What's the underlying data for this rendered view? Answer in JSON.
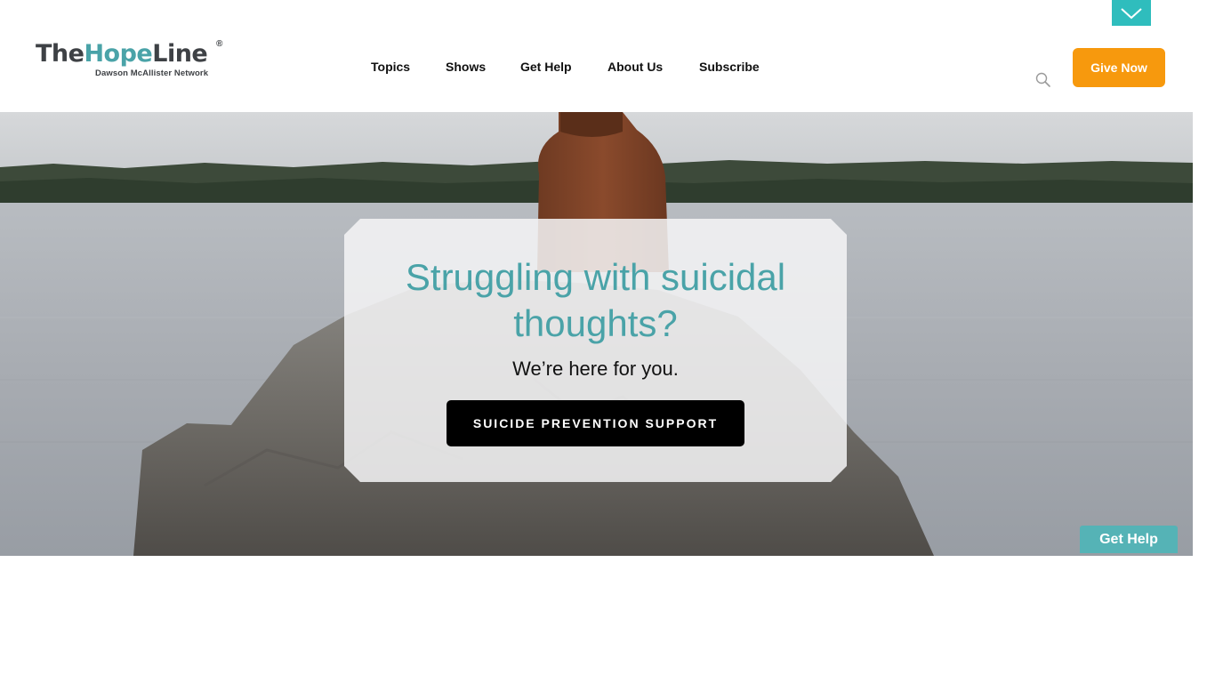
{
  "header": {
    "logo": {
      "the": "The",
      "hope": "Hope",
      "line": "Line",
      "registered": "®",
      "tagline": "Dawson McAllister Network"
    },
    "nav": [
      "Topics",
      "Shows",
      "Get Help",
      "About Us",
      "Subscribe"
    ],
    "search_icon": "search-icon",
    "give_label": "Give Now",
    "toggle_icon": "chevron-down-icon"
  },
  "hero": {
    "title": "Struggling with suicidal thoughts?",
    "subtitle": "We’re here for you.",
    "cta_label": "SUICIDE PREVENTION SUPPORT"
  },
  "floating": {
    "help_label": "Get Help"
  },
  "colors": {
    "brand_teal": "#4aa3a8",
    "accent_orange": "#f7990d",
    "tab_teal": "#2fbdbd",
    "help_teal": "#55b3b6",
    "cta_black": "#000000"
  }
}
